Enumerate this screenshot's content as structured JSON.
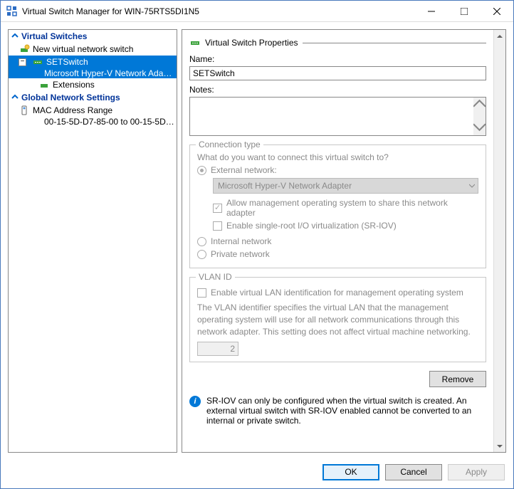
{
  "title": "Virtual Switch Manager for WIN-75RTS5DI1N5",
  "tree": {
    "virtual_switches_header": "Virtual Switches",
    "new_switch": "New virtual network switch",
    "setswitch": "SETSwitch",
    "setswitch_adapter": "Microsoft Hyper-V Network Adapter",
    "extensions": "Extensions",
    "global_header": "Global Network Settings",
    "mac_range": "MAC Address Range",
    "mac_range_value": "00-15-5D-D7-85-00 to 00-15-5D-D..."
  },
  "props": {
    "section_title": "Virtual Switch Properties",
    "name_label": "Name:",
    "name_value": "SETSwitch",
    "notes_label": "Notes:",
    "conn_legend": "Connection type",
    "conn_prompt": "What do you want to connect this virtual switch to?",
    "external": "External network:",
    "adapter_selected": "Microsoft Hyper-V Network Adapter",
    "allow_mgmt": "Allow management operating system to share this network adapter",
    "sriov": "Enable single-root I/O virtualization (SR-IOV)",
    "internal": "Internal network",
    "private": "Private network",
    "vlan_legend": "VLAN ID",
    "vlan_enable": "Enable virtual LAN identification for management operating system",
    "vlan_desc": "The VLAN identifier specifies the virtual LAN that the management operating system will use for all network communications through this network adapter. This setting does not affect virtual machine networking.",
    "vlan_value": "2",
    "remove": "Remove",
    "info_text": "SR-IOV can only be configured when the virtual switch is created. An external virtual switch with SR-IOV enabled cannot be converted to an internal or private switch."
  },
  "footer": {
    "ok": "OK",
    "cancel": "Cancel",
    "apply": "Apply"
  }
}
